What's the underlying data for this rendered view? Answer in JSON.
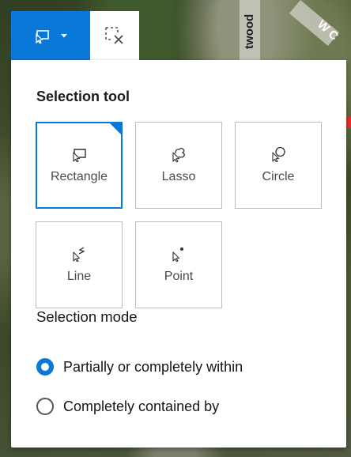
{
  "map": {
    "road_label_1": "twood",
    "road_label_2": "W C"
  },
  "toolbar": {
    "main_icon": "rectangle-select-icon",
    "dropdown_icon": "chevron-down-icon",
    "clear_icon": "clear-selection-icon"
  },
  "panel": {
    "tool_title": "Selection tool",
    "tools": [
      {
        "label": "Rectangle",
        "icon": "rectangle-select-icon",
        "selected": true
      },
      {
        "label": "Lasso",
        "icon": "lasso-select-icon",
        "selected": false
      },
      {
        "label": "Circle",
        "icon": "circle-select-icon",
        "selected": false
      },
      {
        "label": "Line",
        "icon": "line-select-icon",
        "selected": false
      },
      {
        "label": "Point",
        "icon": "point-select-icon",
        "selected": false
      }
    ],
    "mode_title": "Selection mode",
    "modes": [
      {
        "label": "Partially or completely within",
        "checked": true
      },
      {
        "label": "Completely contained by",
        "checked": false
      }
    ]
  },
  "colors": {
    "accent": "#0a78d9"
  }
}
